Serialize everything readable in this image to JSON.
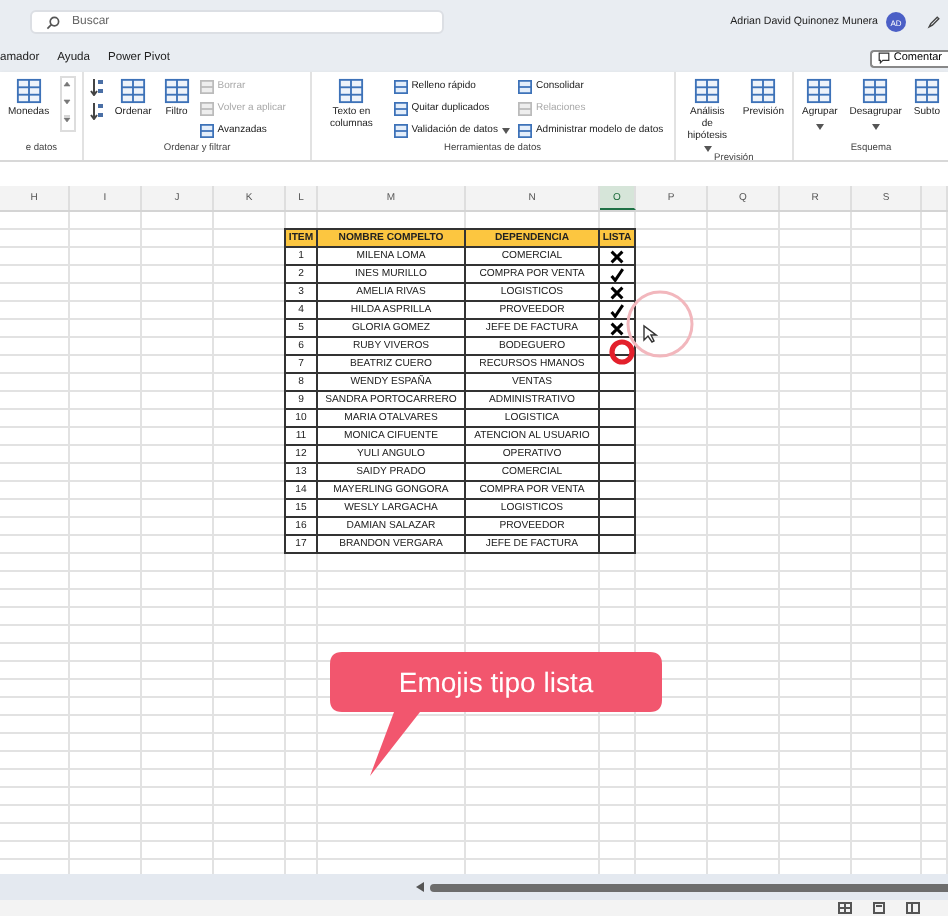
{
  "search": {
    "placeholder": "Buscar"
  },
  "account": {
    "name": "Adrian David Quinonez Munera",
    "initials": "AD"
  },
  "menu": [
    {
      "label": "amador"
    },
    {
      "label": "Ayuda"
    },
    {
      "label": "Power Pivot"
    }
  ],
  "comment_button": "Comentar",
  "ribbon_groups": [
    {
      "label": "e datos",
      "commands": [
        {
          "kind": "large",
          "label": "Monedas",
          "disabled": false,
          "dropdown": false
        },
        {
          "kind": "scroller"
        }
      ]
    },
    {
      "label": "Ordenar y filtrar",
      "commands": [
        {
          "kind": "icon"
        },
        {
          "kind": "icon"
        },
        {
          "kind": "large",
          "label": "Ordenar",
          "disabled": false,
          "dropdown": false
        },
        {
          "kind": "large",
          "label": "Filtro",
          "disabled": false,
          "dropdown": false
        },
        {
          "kind": "small",
          "label": "Borrar",
          "disabled": true,
          "dropdown": false
        },
        {
          "kind": "small",
          "label": "Volver a aplicar",
          "disabled": true,
          "dropdown": false
        },
        {
          "kind": "small",
          "label": "Avanzadas",
          "disabled": false,
          "dropdown": false
        }
      ]
    },
    {
      "label": "Herramientas de datos",
      "commands": [
        {
          "kind": "large",
          "label": "Texto en columnas",
          "disabled": false,
          "dropdown": false
        },
        {
          "kind": "small",
          "label": "Relleno rápido",
          "disabled": false,
          "dropdown": false
        },
        {
          "kind": "small",
          "label": "Quitar duplicados",
          "disabled": false,
          "dropdown": false
        },
        {
          "kind": "small",
          "label": "Validación de datos",
          "disabled": false,
          "dropdown": true
        },
        {
          "kind": "small",
          "label": "Consolidar",
          "disabled": false,
          "dropdown": false
        },
        {
          "kind": "small",
          "label": "Relaciones",
          "disabled": true,
          "dropdown": false
        },
        {
          "kind": "small",
          "label": "Administrar modelo de datos",
          "disabled": false,
          "dropdown": false
        }
      ]
    },
    {
      "label": "Previsión",
      "commands": [
        {
          "kind": "large",
          "label": "Análisis de hipótesis",
          "disabled": false,
          "dropdown": true
        },
        {
          "kind": "large",
          "label": "Previsión",
          "disabled": false,
          "dropdown": false
        }
      ]
    },
    {
      "label": "Esquema",
      "commands": [
        {
          "kind": "large",
          "label": "Agrupar",
          "disabled": false,
          "dropdown": true
        },
        {
          "kind": "large",
          "label": "Desagrupar",
          "disabled": false,
          "dropdown": true
        },
        {
          "kind": "large",
          "label": "Subto",
          "disabled": false,
          "dropdown": false
        }
      ]
    }
  ],
  "columns": [
    {
      "label": "H",
      "selected": false
    },
    {
      "label": "I",
      "selected": false
    },
    {
      "label": "J",
      "selected": false
    },
    {
      "label": "K",
      "selected": false
    },
    {
      "label": "L",
      "selected": false
    },
    {
      "label": "M",
      "selected": false
    },
    {
      "label": "N",
      "selected": false
    },
    {
      "label": "O",
      "selected": true
    },
    {
      "label": "P",
      "selected": false
    },
    {
      "label": "Q",
      "selected": false
    },
    {
      "label": "R",
      "selected": false
    },
    {
      "label": "S",
      "selected": false
    }
  ],
  "table": {
    "headers": [
      "ITEM",
      "NOMBRE COMPELTO",
      "DEPENDENCIA",
      "LISTA"
    ],
    "rows": [
      {
        "item": "1",
        "name": "MILENA LOMA",
        "department": "COMERCIAL",
        "lista": {
          "kind": "cross"
        }
      },
      {
        "item": "2",
        "name": "INES MURILLO",
        "department": "COMPRA POR VENTA",
        "lista": {
          "kind": "check"
        }
      },
      {
        "item": "3",
        "name": "AMELIA RIVAS",
        "department": "LOGISTICOS",
        "lista": {
          "kind": "cross"
        }
      },
      {
        "item": "4",
        "name": "HILDA ASPRILLA",
        "department": "PROVEEDOR",
        "lista": {
          "kind": "check"
        }
      },
      {
        "item": "5",
        "name": "GLORIA GOMEZ",
        "department": "JEFE DE FACTURA",
        "lista": {
          "kind": "cross"
        }
      },
      {
        "item": "6",
        "name": "RUBY VIVEROS",
        "department": "BODEGUERO"
      },
      {
        "item": "7",
        "name": "BEATRIZ CUERO",
        "department": "RECURSOS HMANOS"
      },
      {
        "item": "8",
        "name": "WENDY ESPAÑA",
        "department": "VENTAS"
      },
      {
        "item": "9",
        "name": "SANDRA PORTOCARRERO",
        "department": "ADMINISTRATIVO"
      },
      {
        "item": "10",
        "name": "MARIA OTALVARES",
        "department": "LOGISTICA"
      },
      {
        "item": "11",
        "name": "MONICA CIFUENTE",
        "department": "ATENCION AL USUARIO"
      },
      {
        "item": "12",
        "name": "YULI ANGULO",
        "department": "OPERATIVO"
      },
      {
        "item": "13",
        "name": "SAIDY PRADO",
        "department": "COMERCIAL"
      },
      {
        "item": "14",
        "name": "MAYERLING GONGORA",
        "department": "COMPRA POR VENTA"
      },
      {
        "item": "15",
        "name": "WESLY LARGACHA",
        "department": "LOGISTICOS"
      },
      {
        "item": "16",
        "name": "DAMIAN SALAZAR",
        "department": "PROVEEDOR"
      },
      {
        "item": "17",
        "name": "BRANDON VERGARA",
        "department": "JEFE DE FACTURA"
      }
    ]
  },
  "callout": {
    "text": "Emojis tipo lista"
  }
}
